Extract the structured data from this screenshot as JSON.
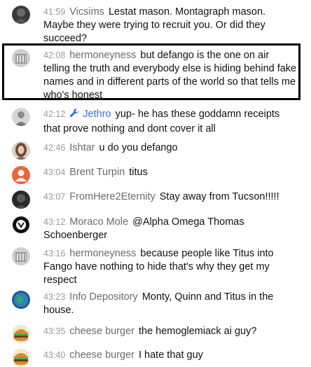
{
  "colors": {
    "time": "#9a9a9a",
    "author": "#6b6b6b",
    "moderator_author": "#2f6fe0",
    "message_text": "#111111",
    "highlight_border": "#000000"
  },
  "messages": [
    {
      "time": "41:59",
      "author": "Vicsims",
      "text": "Lestat mason. Montagraph mason. Maybe they were trying to recruit you. Or did they succeed?",
      "avatar_icon": "dark-profile-avatar-icon"
    },
    {
      "time": "42:08",
      "author": "hermoneyness",
      "text": "but defango is the one on air telling the truth and everybody else is hiding behind fake names and in different parts of the world so that tells me who's honest",
      "avatar_icon": "grey-building-avatar-icon"
    },
    {
      "time": "42:12",
      "author": "Jethro",
      "moderator_icon": "wrench-icon",
      "text": "yup- he has these goddamn receipts that prove nothing and dont cover it all",
      "avatar_icon": "grey-person-avatar-icon"
    },
    {
      "time": "42:46",
      "author": "Ishtar",
      "text": "u do you defango",
      "avatar_icon": "woman-photo-avatar-icon"
    },
    {
      "time": "43:04",
      "author": "Brent Turpin",
      "text": "titus",
      "avatar_icon": "default-orange-avatar-icon"
    },
    {
      "time": "43:07",
      "author": "FromHere2Eternity",
      "text": "Stay away from Tucson!!!!!",
      "avatar_icon": "dark-figure-avatar-icon"
    },
    {
      "time": "43:12",
      "author": "Moraco Mole",
      "text": "@Alpha Omega Thomas Schoenberger",
      "avatar_icon": "black-emblem-avatar-icon"
    },
    {
      "time": "43:16",
      "author": "hermoneyness",
      "text": "because people like Titus into Fango have nothing to hide that's why they get my respect",
      "avatar_icon": "grey-building-avatar-icon"
    },
    {
      "time": "43:23",
      "author": "Info Depository",
      "text": "Monty, Quinn and Titus in the house.",
      "avatar_icon": "blue-green-globe-avatar-icon"
    },
    {
      "time": "43:35",
      "author": "cheese burger",
      "text": "the hemoglemiack ai guy?",
      "avatar_icon": "burger-avatar-icon"
    },
    {
      "time": "43:40",
      "author": "cheese burger",
      "text": "I hate that guy",
      "avatar_icon": "burger-avatar-icon"
    }
  ]
}
